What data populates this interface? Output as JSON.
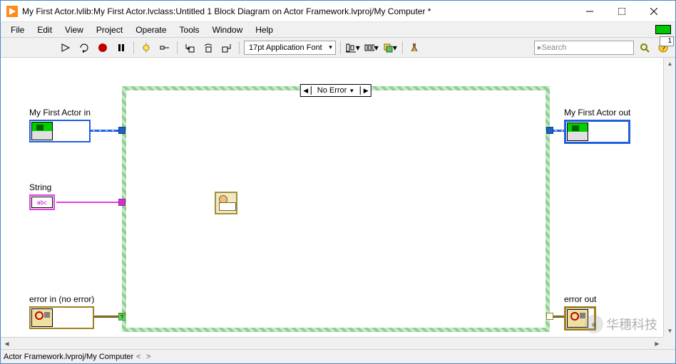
{
  "title": "My First Actor.lvlib:My First Actor.lvclass:Untitled 1 Block Diagram on Actor Framework.lvproj/My Computer *",
  "menu": {
    "file": "File",
    "edit": "Edit",
    "view": "View",
    "project": "Project",
    "operate": "Operate",
    "tools": "Tools",
    "window": "Window",
    "help": "Help"
  },
  "toolbar": {
    "font": "17pt Application Font",
    "search_placeholder": "Search"
  },
  "case": {
    "label": "No Error"
  },
  "terminals": {
    "actor_in": "My First Actor in",
    "actor_out": "My First Actor out",
    "string": "String",
    "abc": "abc",
    "error_in": "error in (no error)",
    "error_out": "error out"
  },
  "status": {
    "path": "Actor Framework.lvproj/My Computer"
  },
  "watermark": "华穗科技",
  "idx": "1"
}
